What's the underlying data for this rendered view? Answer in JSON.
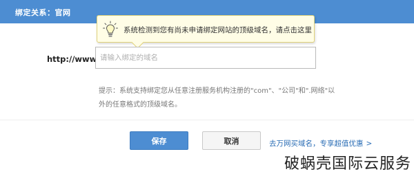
{
  "header": {
    "title": "绑定关系：官网"
  },
  "tip": {
    "text": "系统检测到您有尚未申请绑定网站的顶级域名，请点击这里",
    "icon": "lightbulb-icon"
  },
  "form": {
    "prefix_label": "http://www.",
    "domain_placeholder": "请输入绑定的域名",
    "hint_line1": "提示：系统支持绑定您从任意注册服务机构注册的\"com\"、\"公司\"和\".网络\"以",
    "hint_line2": "外的任意格式的顶级域名。"
  },
  "actions": {
    "save_label": "保存",
    "cancel_label": "取消",
    "promo_link": "去万网买域名，专享超值优惠",
    "promo_chevron": ">"
  },
  "watermark": {
    "text": "破蜗壳国际云服务"
  },
  "colors": {
    "header_bg": "#4d8dd2",
    "primary_button": "#4d8dd2",
    "link": "#2a6db5",
    "tip_bg": "#fffde6"
  }
}
